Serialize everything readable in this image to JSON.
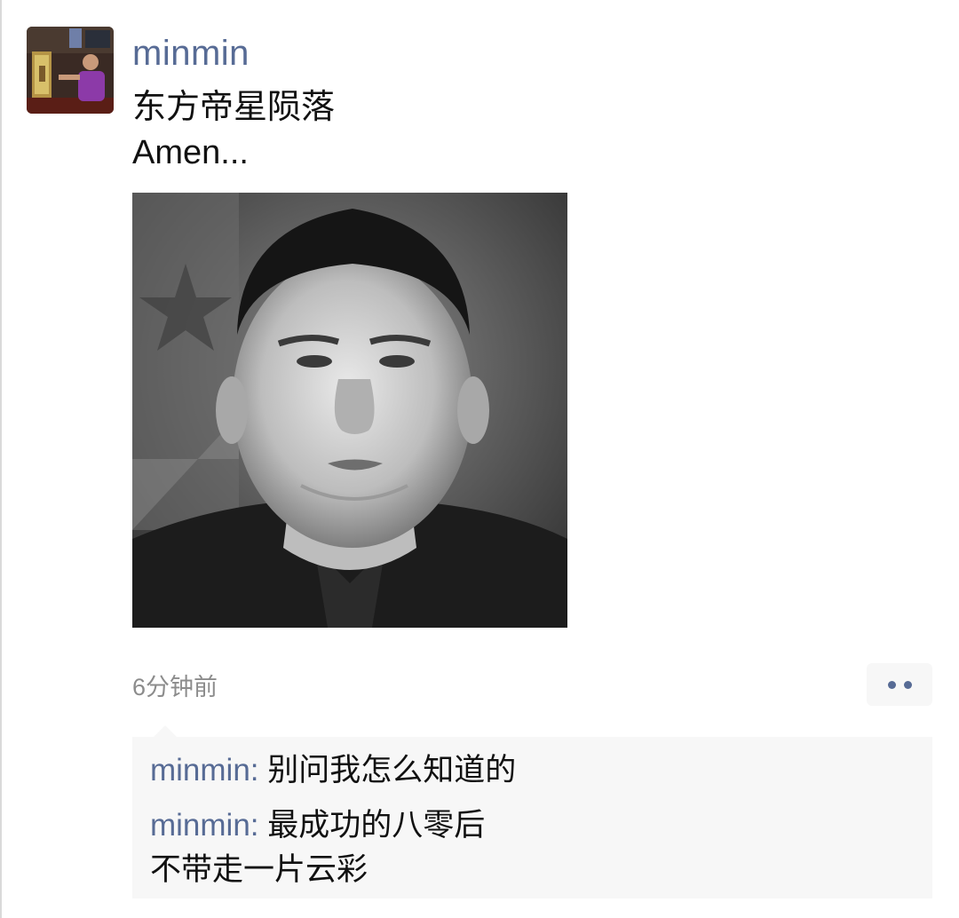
{
  "post": {
    "author": "minmin",
    "text": "东方帝星陨落\nAmen...",
    "timestamp": "6分钟前"
  },
  "comments": [
    {
      "author": "minmin",
      "separator": ": ",
      "text": "别问我怎么知道的"
    },
    {
      "author": "minmin",
      "separator": ": ",
      "text": "最成功的八零后\n不带走一片云彩"
    }
  ],
  "colors": {
    "link_blue": "#576b95",
    "comment_bg": "#f7f7f7",
    "timestamp_gray": "#8c8c8c"
  },
  "icons": {
    "more": "more-dots-icon"
  }
}
